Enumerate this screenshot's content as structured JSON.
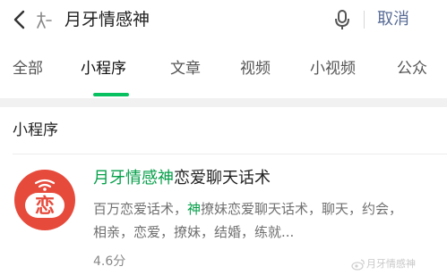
{
  "search": {
    "query": "月牙情感神",
    "cancel_label": "取消"
  },
  "tabs": [
    {
      "label": "全部",
      "active": false
    },
    {
      "label": "小程序",
      "active": true
    },
    {
      "label": "文章",
      "active": false
    },
    {
      "label": "视频",
      "active": false
    },
    {
      "label": "小视频",
      "active": false
    },
    {
      "label": "公众",
      "active": false
    }
  ],
  "section": {
    "title": "小程序"
  },
  "result": {
    "name_highlight": "月牙情感神",
    "name_rest": "恋爱聊天话术",
    "logo_char": "恋",
    "desc_before": "百万恋爱话术，",
    "desc_highlight": "神",
    "desc_after": "撩妹恋爱聊天话术，聊天，约会，相亲，恋爱，撩妹，结婚，练就...",
    "rating": "4.6分"
  },
  "watermark": {
    "text": "月牙情感神"
  },
  "colors": {
    "accent_green": "#07c160",
    "highlight_green": "#07a04b",
    "cancel_blue": "#576b95",
    "logo_red": "#e64a3b"
  },
  "icons": {
    "back": "chevron-left-icon",
    "search_prefix": "sparkle-icon",
    "mic": "microphone-icon",
    "watermark": "weibo-icon"
  }
}
